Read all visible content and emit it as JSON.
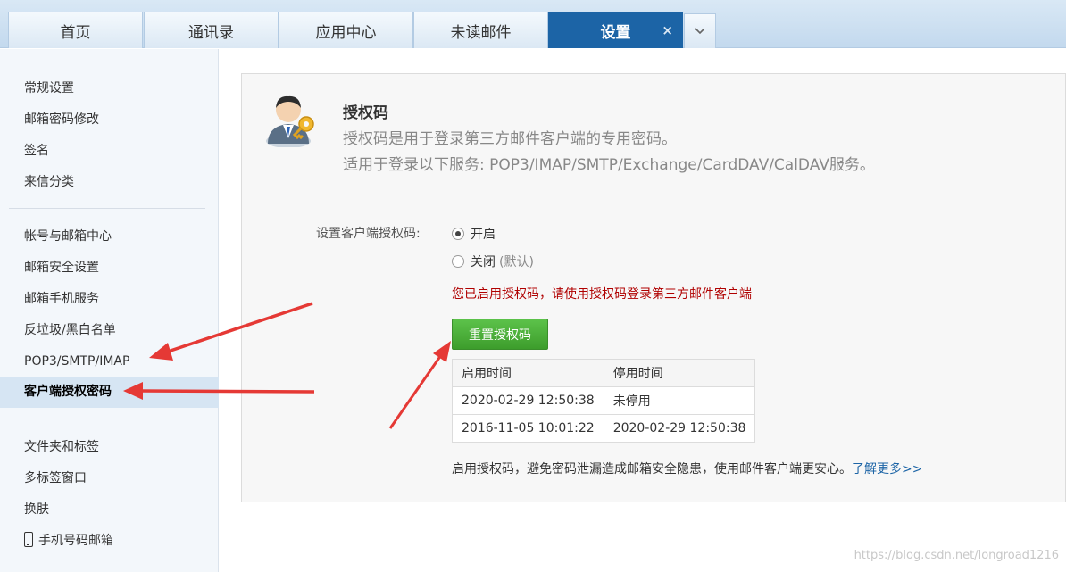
{
  "tabs": [
    {
      "label": "首页"
    },
    {
      "label": "通讯录"
    },
    {
      "label": "应用中心"
    },
    {
      "label": "未读邮件"
    },
    {
      "label": "设置",
      "active": true,
      "close": "×"
    }
  ],
  "sidebar": {
    "group1": [
      "常规设置",
      "邮箱密码修改",
      "签名",
      "来信分类"
    ],
    "group2": [
      "帐号与邮箱中心",
      "邮箱安全设置",
      "邮箱手机服务",
      "反垃圾/黑白名单",
      "POP3/SMTP/IMAP",
      "客户端授权密码"
    ],
    "group3": [
      "文件夹和标签",
      "多标签窗口",
      "换肤",
      "手机号码邮箱"
    ]
  },
  "header": {
    "title": "授权码",
    "desc1": "授权码是用于登录第三方邮件客户端的专用密码。",
    "desc2": "适用于登录以下服务: POP3/IMAP/SMTP/Exchange/CardDAV/CalDAV服务。"
  },
  "form": {
    "label": "设置客户端授权码:",
    "option_on": "开启",
    "option_off": "关闭",
    "option_off_note": "(默认)",
    "selected": "on",
    "notice": "您已启用授权码，请使用授权码登录第三方邮件客户端",
    "reset_button": "重置授权码"
  },
  "history": {
    "headers": [
      "启用时间",
      "停用时间"
    ],
    "rows": [
      [
        "2020-02-29 12:50:38",
        "未停用"
      ],
      [
        "2016-11-05 10:01:22",
        "2020-02-29 12:50:38"
      ]
    ]
  },
  "footer": {
    "text": "启用授权码，避免密码泄漏造成邮箱安全隐患，使用邮件客户端更安心。",
    "link": "了解更多>>"
  },
  "watermark": "https://blog.csdn.net/longroad1216",
  "colors": {
    "accent": "#1c64a6",
    "button": "#4cae3a",
    "notice": "#b00000",
    "annotation_arrow": "#e53935"
  }
}
